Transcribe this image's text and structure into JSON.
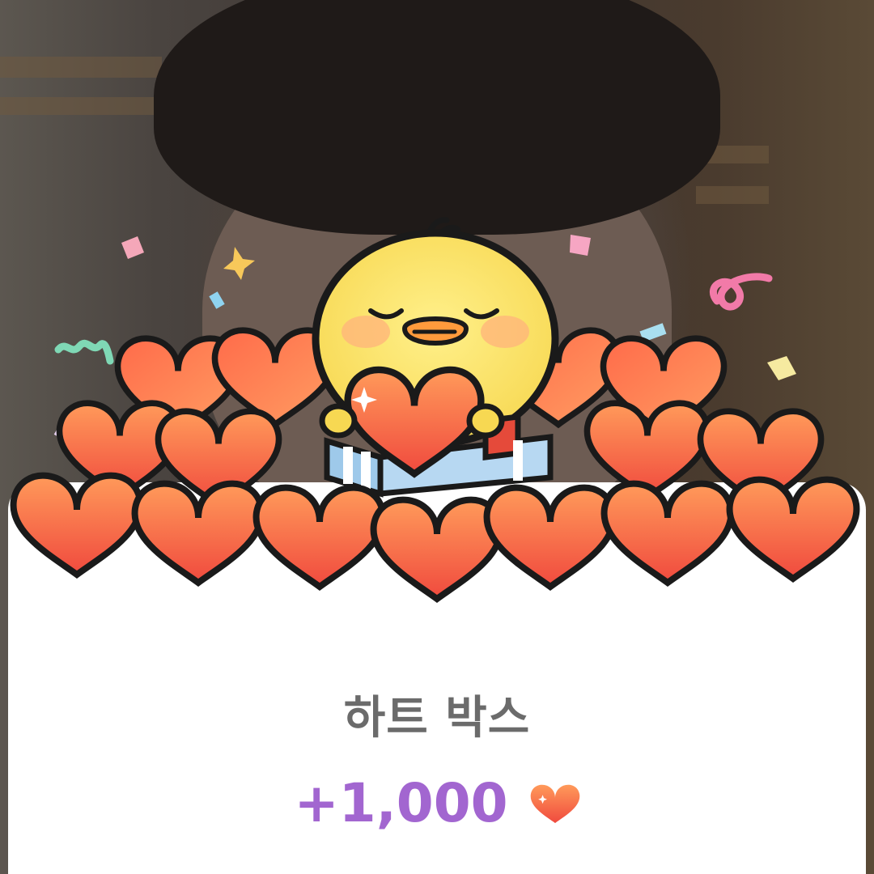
{
  "item": {
    "title": "하트 박스",
    "reward_amount": "+1,000",
    "reward_icon": "heart-icon"
  },
  "colors": {
    "title_text": "#6b6b6b",
    "reward_text": "#a266d0",
    "heart_top": "#ff9a5a",
    "heart_bottom": "#f04a3e",
    "card_background": "#ffffff"
  }
}
